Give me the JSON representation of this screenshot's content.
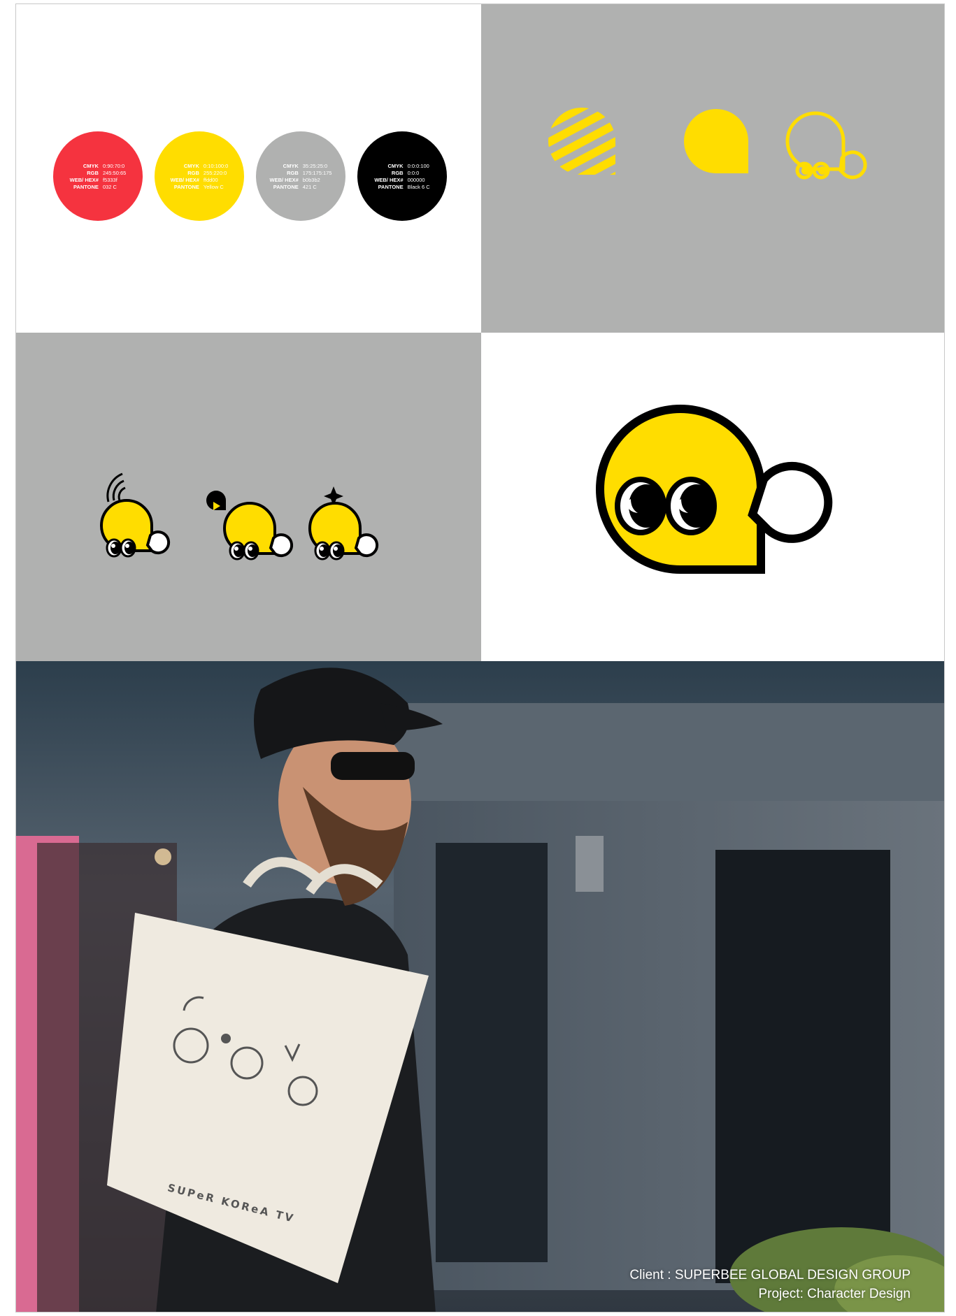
{
  "colors": {
    "red": "#f5333f",
    "yellow": "#ffdd00",
    "grey": "#b0b1b0",
    "black": "#000000",
    "panel_grey": "#b0b1b0"
  },
  "swatches": [
    {
      "fill": "#f5333f",
      "text_color": "#ffffff",
      "rows": [
        {
          "k": "CMYK",
          "v": "0:90:70:0"
        },
        {
          "k": "RGB",
          "v": "245:50:65"
        },
        {
          "k": "WEB/ HEX#",
          "v": "f5333f"
        },
        {
          "k": "PANTONE",
          "v": "032 C"
        }
      ]
    },
    {
      "fill": "#ffdd00",
      "text_color": "#ffffff",
      "rows": [
        {
          "k": "CMYK",
          "v": "0:10:100:0"
        },
        {
          "k": "RGB",
          "v": "255:220:0"
        },
        {
          "k": "WEB/ HEX#",
          "v": "ffdd00"
        },
        {
          "k": "PANTONE",
          "v": "Yellow C"
        }
      ]
    },
    {
      "fill": "#b0b1b0",
      "text_color": "#ffffff",
      "rows": [
        {
          "k": "CMYK",
          "v": "35:25:25:0"
        },
        {
          "k": "RGB",
          "v": "175:175:175"
        },
        {
          "k": "WEB/ HEX#",
          "v": "b0b3b2"
        },
        {
          "k": "PANTONE",
          "v": "421 C"
        }
      ]
    },
    {
      "fill": "#000000",
      "text_color": "#ffffff",
      "rows": [
        {
          "k": "CMYK",
          "v": "0:0:0:100"
        },
        {
          "k": "RGB",
          "v": "0:0:0"
        },
        {
          "k": "WEB/ HEX#",
          "v": "000000"
        },
        {
          "k": "PANTONE",
          "v": "Black 6 C"
        }
      ]
    }
  ],
  "bag_text": "SUPeR KOReA TV",
  "caption": {
    "line1": "Client : SUPERBEE GLOBAL DESIGN GROUP",
    "line2": "Project: Character Design"
  }
}
